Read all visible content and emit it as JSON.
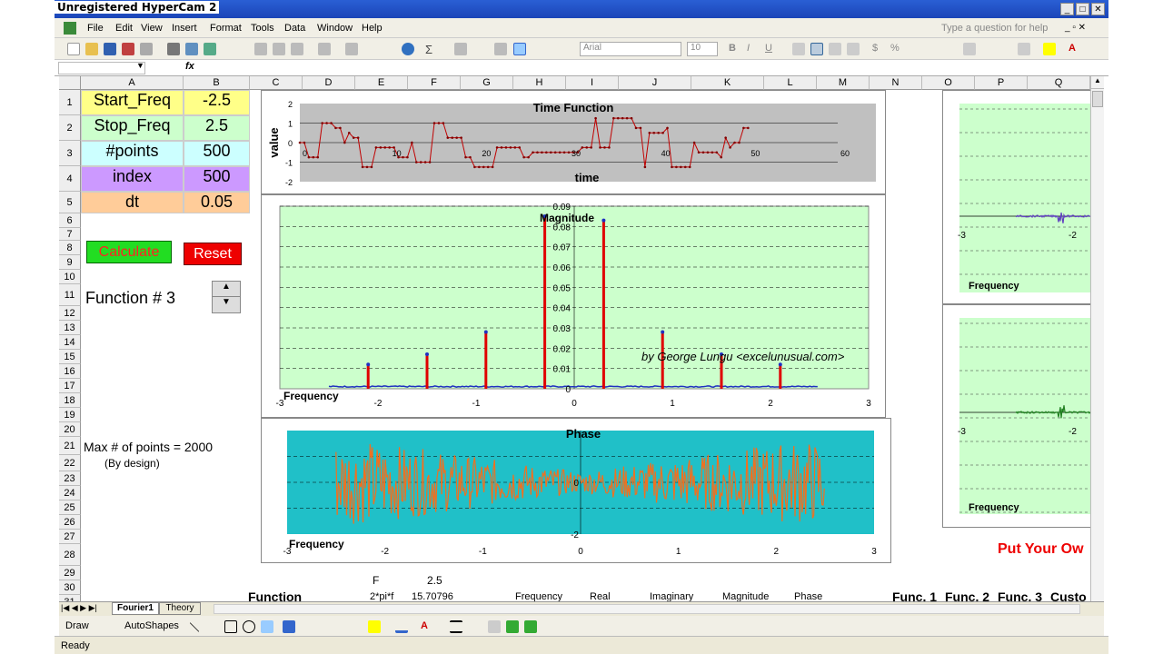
{
  "window": {
    "title": "Unregistered HyperCam 2"
  },
  "menu": [
    "File",
    "Edit",
    "View",
    "Insert",
    "Format",
    "Tools",
    "Data",
    "Window",
    "Help"
  ],
  "help_placeholder": "Type a question for help",
  "font": {
    "name": "Arial",
    "size": "10"
  },
  "columns": [
    "A",
    "B",
    "C",
    "D",
    "E",
    "F",
    "G",
    "H",
    "I",
    "J",
    "K",
    "L",
    "M",
    "N",
    "O",
    "P",
    "Q"
  ],
  "rows": [
    "1",
    "2",
    "3",
    "4",
    "5",
    "6",
    "7",
    "8",
    "9",
    "10",
    "11",
    "12",
    "13",
    "14",
    "15",
    "16",
    "17",
    "18",
    "19",
    "20",
    "21",
    "22",
    "23",
    "24",
    "25",
    "26",
    "27",
    "28",
    "29",
    "30",
    "31"
  ],
  "params": [
    {
      "label": "Start_Freq",
      "value": "-2.5"
    },
    {
      "label": "Stop_Freq",
      "value": "2.5"
    },
    {
      "label": "#points",
      "value": "500"
    },
    {
      "label": "index",
      "value": "500"
    },
    {
      "label": "dt",
      "value": "0.05"
    }
  ],
  "buttons": {
    "calculate": "Calculate",
    "reset": "Reset"
  },
  "function_label": "Function # 3",
  "max_points": "Max # of points = 2000",
  "by_design": "(By design)",
  "row30": {
    "e": "F",
    "f": "2.5"
  },
  "row31": {
    "c": "Function",
    "e": "2*pi*f",
    "f": "15.70796",
    "h": "Frequency",
    "i": "Real",
    "j": "Imaginary",
    "k": "Magnitude",
    "l": "Phase",
    "n": "Func. 1",
    "o": "Func. 2",
    "p": "Func. 3",
    "q": "Custo"
  },
  "put_your_own": "Put Your Ow",
  "sheets": [
    "Fourier1",
    "Theory"
  ],
  "drawbar": {
    "draw": "Draw",
    "autoshapes": "AutoShapes"
  },
  "status": "Ready",
  "chart_data": [
    {
      "type": "line",
      "title": "Time Function",
      "xlabel": "time",
      "ylabel": "value",
      "xlim": [
        0,
        60
      ],
      "ylim": [
        -2,
        2
      ],
      "xticks": [
        "0",
        "10",
        "20",
        "30",
        "40",
        "50",
        "60"
      ],
      "yticks": [
        "2",
        "1",
        "0",
        "-1",
        "-2"
      ]
    },
    {
      "type": "line",
      "title": "Magnitude",
      "xlabel": "Frequency",
      "xlim": [
        -3,
        3
      ],
      "ylim": [
        0,
        0.09
      ],
      "xticks": [
        "-3",
        "-2",
        "-1",
        "0",
        "1",
        "2",
        "3"
      ],
      "yticks": [
        "0.09",
        "0.08",
        "0.07",
        "0.06",
        "0.05",
        "0.04",
        "0.03",
        "0.02",
        "0.01",
        "0"
      ],
      "annotation": "by George Lungu <excelunusual.com>",
      "peaks": [
        {
          "x": -2.1,
          "y": 0.012
        },
        {
          "x": -1.5,
          "y": 0.017
        },
        {
          "x": -0.9,
          "y": 0.028
        },
        {
          "x": -0.3,
          "y": 0.085
        },
        {
          "x": 0.3,
          "y": 0.083
        },
        {
          "x": 0.9,
          "y": 0.028
        },
        {
          "x": 1.5,
          "y": 0.017
        },
        {
          "x": 2.1,
          "y": 0.012
        }
      ]
    },
    {
      "type": "line",
      "title": "Phase",
      "xlabel": "Frequency",
      "xlim": [
        -3,
        3
      ],
      "ylim": [
        -2,
        2
      ],
      "xticks": [
        "-3",
        "-2",
        "-1",
        "0",
        "1",
        "2",
        "3"
      ],
      "yticks": [
        "0",
        "-2"
      ]
    },
    {
      "type": "line",
      "xlabel": "Frequency",
      "xticks": [
        "-3",
        "-2"
      ]
    },
    {
      "type": "line",
      "xlabel": "Frequency",
      "xticks": [
        "-3",
        "-2"
      ]
    }
  ]
}
